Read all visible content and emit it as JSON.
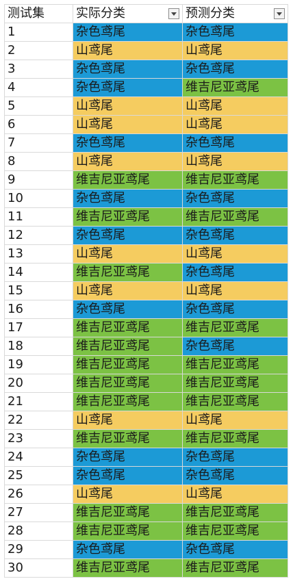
{
  "headers": {
    "id": "测试集",
    "actual": "实际分类",
    "predicted": "预测分类"
  },
  "colors": {
    "杂色鸢尾": "#1c9ad6",
    "山鸢尾": "#f5cc60",
    "维吉尼亚鸢尾": "#7cc244"
  },
  "rows": [
    {
      "id": "1",
      "actual": "杂色鸢尾",
      "predicted": "杂色鸢尾"
    },
    {
      "id": "2",
      "actual": "山鸢尾",
      "predicted": "山鸢尾"
    },
    {
      "id": "3",
      "actual": "杂色鸢尾",
      "predicted": "杂色鸢尾"
    },
    {
      "id": "4",
      "actual": "杂色鸢尾",
      "predicted": "维吉尼亚鸢尾"
    },
    {
      "id": "5",
      "actual": "山鸢尾",
      "predicted": "山鸢尾"
    },
    {
      "id": "6",
      "actual": "山鸢尾",
      "predicted": "山鸢尾"
    },
    {
      "id": "7",
      "actual": "杂色鸢尾",
      "predicted": "杂色鸢尾"
    },
    {
      "id": "8",
      "actual": "山鸢尾",
      "predicted": "山鸢尾"
    },
    {
      "id": "9",
      "actual": "维吉尼亚鸢尾",
      "predicted": "维吉尼亚鸢尾"
    },
    {
      "id": "10",
      "actual": "杂色鸢尾",
      "predicted": "杂色鸢尾"
    },
    {
      "id": "11",
      "actual": "维吉尼亚鸢尾",
      "predicted": "维吉尼亚鸢尾"
    },
    {
      "id": "12",
      "actual": "杂色鸢尾",
      "predicted": "杂色鸢尾"
    },
    {
      "id": "13",
      "actual": "山鸢尾",
      "predicted": "山鸢尾"
    },
    {
      "id": "14",
      "actual": "维吉尼亚鸢尾",
      "predicted": "杂色鸢尾"
    },
    {
      "id": "15",
      "actual": "山鸢尾",
      "predicted": "山鸢尾"
    },
    {
      "id": "16",
      "actual": "杂色鸢尾",
      "predicted": "杂色鸢尾"
    },
    {
      "id": "17",
      "actual": "维吉尼亚鸢尾",
      "predicted": "维吉尼亚鸢尾"
    },
    {
      "id": "18",
      "actual": "维吉尼亚鸢尾",
      "predicted": "杂色鸢尾"
    },
    {
      "id": "19",
      "actual": "维吉尼亚鸢尾",
      "predicted": "维吉尼亚鸢尾"
    },
    {
      "id": "20",
      "actual": "维吉尼亚鸢尾",
      "predicted": "维吉尼亚鸢尾"
    },
    {
      "id": "21",
      "actual": "维吉尼亚鸢尾",
      "predicted": "维吉尼亚鸢尾"
    },
    {
      "id": "22",
      "actual": "山鸢尾",
      "predicted": "山鸢尾"
    },
    {
      "id": "23",
      "actual": "维吉尼亚鸢尾",
      "predicted": "维吉尼亚鸢尾"
    },
    {
      "id": "24",
      "actual": "杂色鸢尾",
      "predicted": "杂色鸢尾"
    },
    {
      "id": "25",
      "actual": "杂色鸢尾",
      "predicted": "杂色鸢尾"
    },
    {
      "id": "26",
      "actual": "山鸢尾",
      "predicted": "山鸢尾"
    },
    {
      "id": "27",
      "actual": "维吉尼亚鸢尾",
      "predicted": "维吉尼亚鸢尾"
    },
    {
      "id": "28",
      "actual": "维吉尼亚鸢尾",
      "predicted": "维吉尼亚鸢尾"
    },
    {
      "id": "29",
      "actual": "杂色鸢尾",
      "predicted": "杂色鸢尾"
    },
    {
      "id": "30",
      "actual": "维吉尼亚鸢尾",
      "predicted": "维吉尼亚鸢尾"
    }
  ]
}
